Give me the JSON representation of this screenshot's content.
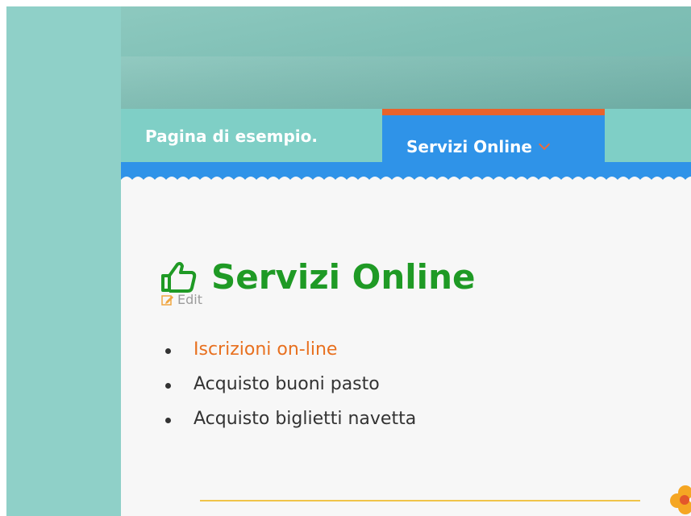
{
  "nav": {
    "example_page_label": "Pagina di esempio.",
    "active_tab_label": "Servizi Online"
  },
  "page": {
    "title": "Servizi Online",
    "edit_label": "Edit"
  },
  "services": [
    {
      "label": "Iscrizioni on-line",
      "is_link": true
    },
    {
      "label": "Acquisto buoni pasto",
      "is_link": false
    },
    {
      "label": "Acquisto biglietti navetta",
      "is_link": false
    }
  ],
  "colors": {
    "background_teal": "#8fd0c8",
    "nav_teal": "#7fcfc6",
    "active_tab_blue": "#2f93e8",
    "active_tab_border_orange": "#e8632c",
    "title_green": "#1f9a25",
    "link_orange": "#e8701f",
    "divider_yellow": "#f0c44a"
  },
  "icons": {
    "title_icon": "thumbs-up-outline-icon",
    "edit_icon": "edit-pencil-icon",
    "tab_dropdown_icon": "chevron-down-icon",
    "decoration_icon": "flower-icon"
  }
}
